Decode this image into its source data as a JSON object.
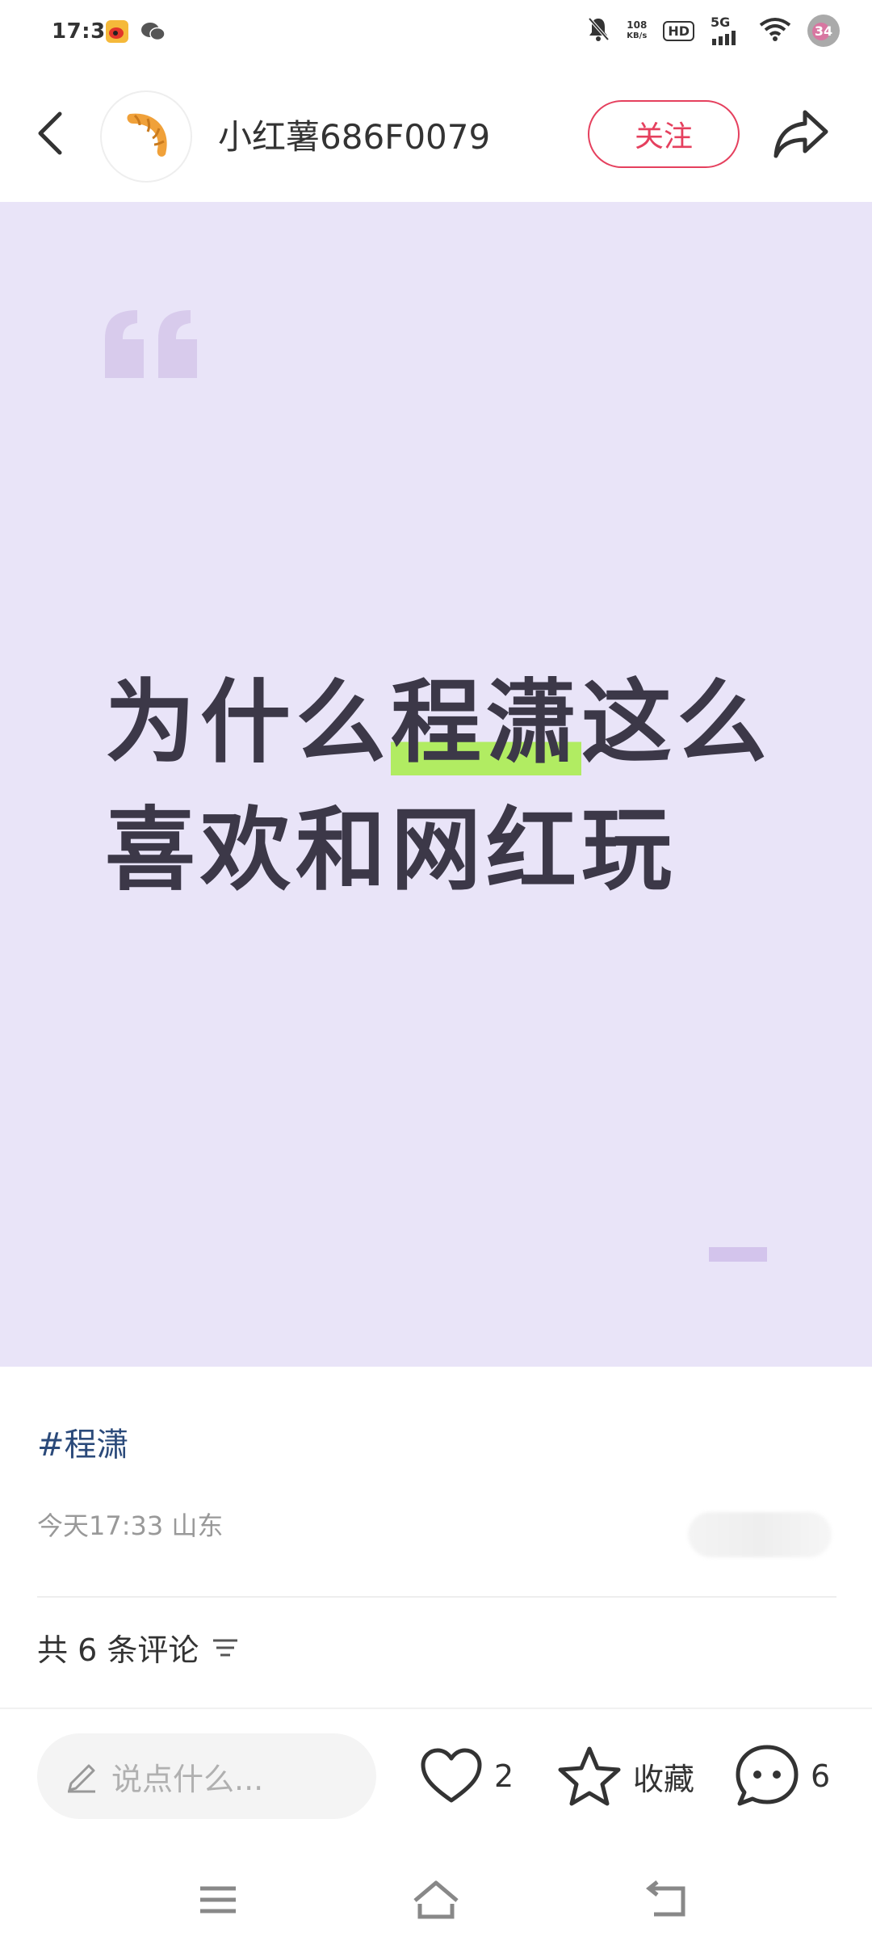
{
  "status_bar": {
    "time": "17:39",
    "net_speed_value": "108",
    "net_speed_unit": "KB/s",
    "hd": "HD",
    "network": "5G",
    "battery": "34"
  },
  "header": {
    "username": "小红薯686F0079",
    "follow_label": "关注"
  },
  "post": {
    "title_part1": "为什么",
    "title_highlight": "程潇",
    "title_part2": "这么喜欢和网红玩",
    "hashtag": "#程潇",
    "meta": "今天17:33 山东",
    "comment_count": "共 6 条评论"
  },
  "bottom_bar": {
    "input_placeholder": "说点什么...",
    "likes": "2",
    "collect_label": "收藏",
    "comments": "6"
  },
  "colors": {
    "accent": "#e5405e",
    "card_bg": "#e9e4f8",
    "highlight": "#b1ec62",
    "hashtag": "#2b4a7a"
  },
  "icons": [
    "back-icon",
    "avatar-croissant",
    "share-icon",
    "quote-icon",
    "filter-icon",
    "pencil-icon",
    "heart-icon",
    "star-icon",
    "comment-bubble-icon",
    "menu-icon",
    "home-icon",
    "back-nav-icon"
  ]
}
